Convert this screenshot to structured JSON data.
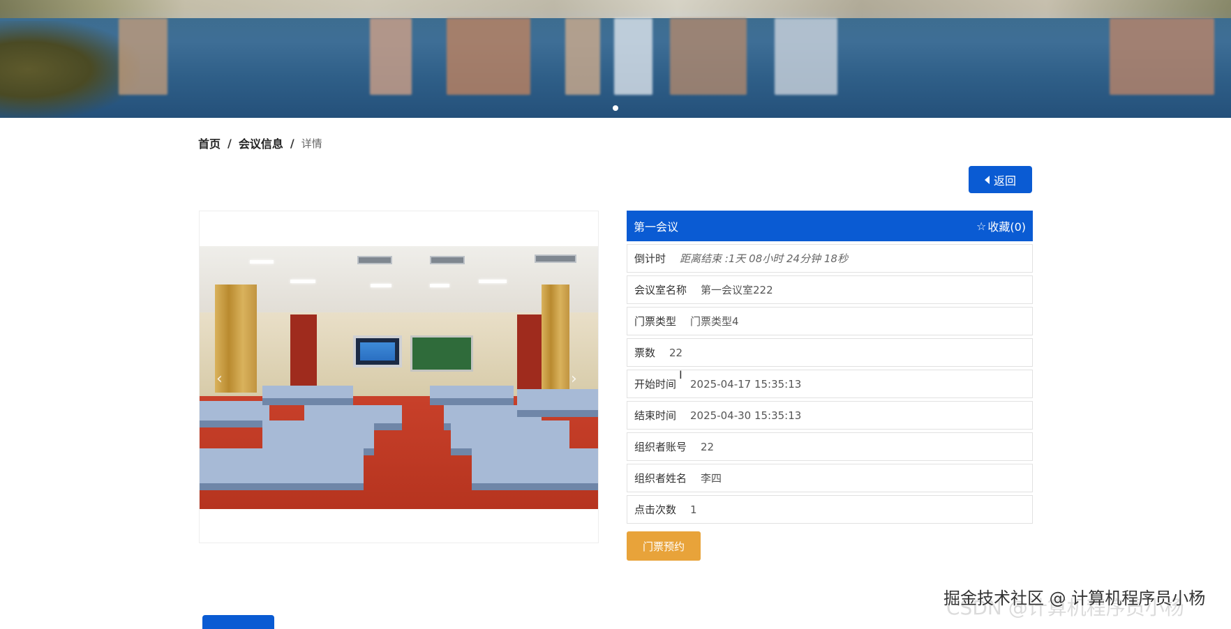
{
  "banner": {
    "carousel_dot_count": 1
  },
  "breadcrumb": {
    "home": "首页",
    "section": "会议信息",
    "current": "详情",
    "separator": "/"
  },
  "back_button": {
    "label": "返回",
    "icon": "caret-left-icon"
  },
  "detail": {
    "title": "第一会议",
    "favorite_label": "收藏(0)",
    "favorite_icon": "star-outline-icon",
    "rows": [
      {
        "label": "倒计时",
        "value": "距离结束 :1天 08小时 24分钟 18秒"
      },
      {
        "label": "会议室名称",
        "value": "第一会议室222"
      },
      {
        "label": "门票类型",
        "value": "门票类型4"
      },
      {
        "label": "票数",
        "value": "22"
      },
      {
        "label": "开始时间",
        "value": "2025-04-17 15:35:13"
      },
      {
        "label": "结束时间",
        "value": "2025-04-30 15:35:13"
      },
      {
        "label": "组织者账号",
        "value": "22"
      },
      {
        "label": "组织者姓名",
        "value": "李四"
      },
      {
        "label": "点击次数",
        "value": "1"
      }
    ]
  },
  "booking_button": {
    "label": "门票预约"
  },
  "watermark": {
    "text": "掘金技术社区 @ 计算机程序员小杨",
    "ghost": "CSDN @计算机程序员小杨"
  },
  "colors": {
    "primary": "#0a5bd3",
    "booking": "#e8a33a"
  }
}
